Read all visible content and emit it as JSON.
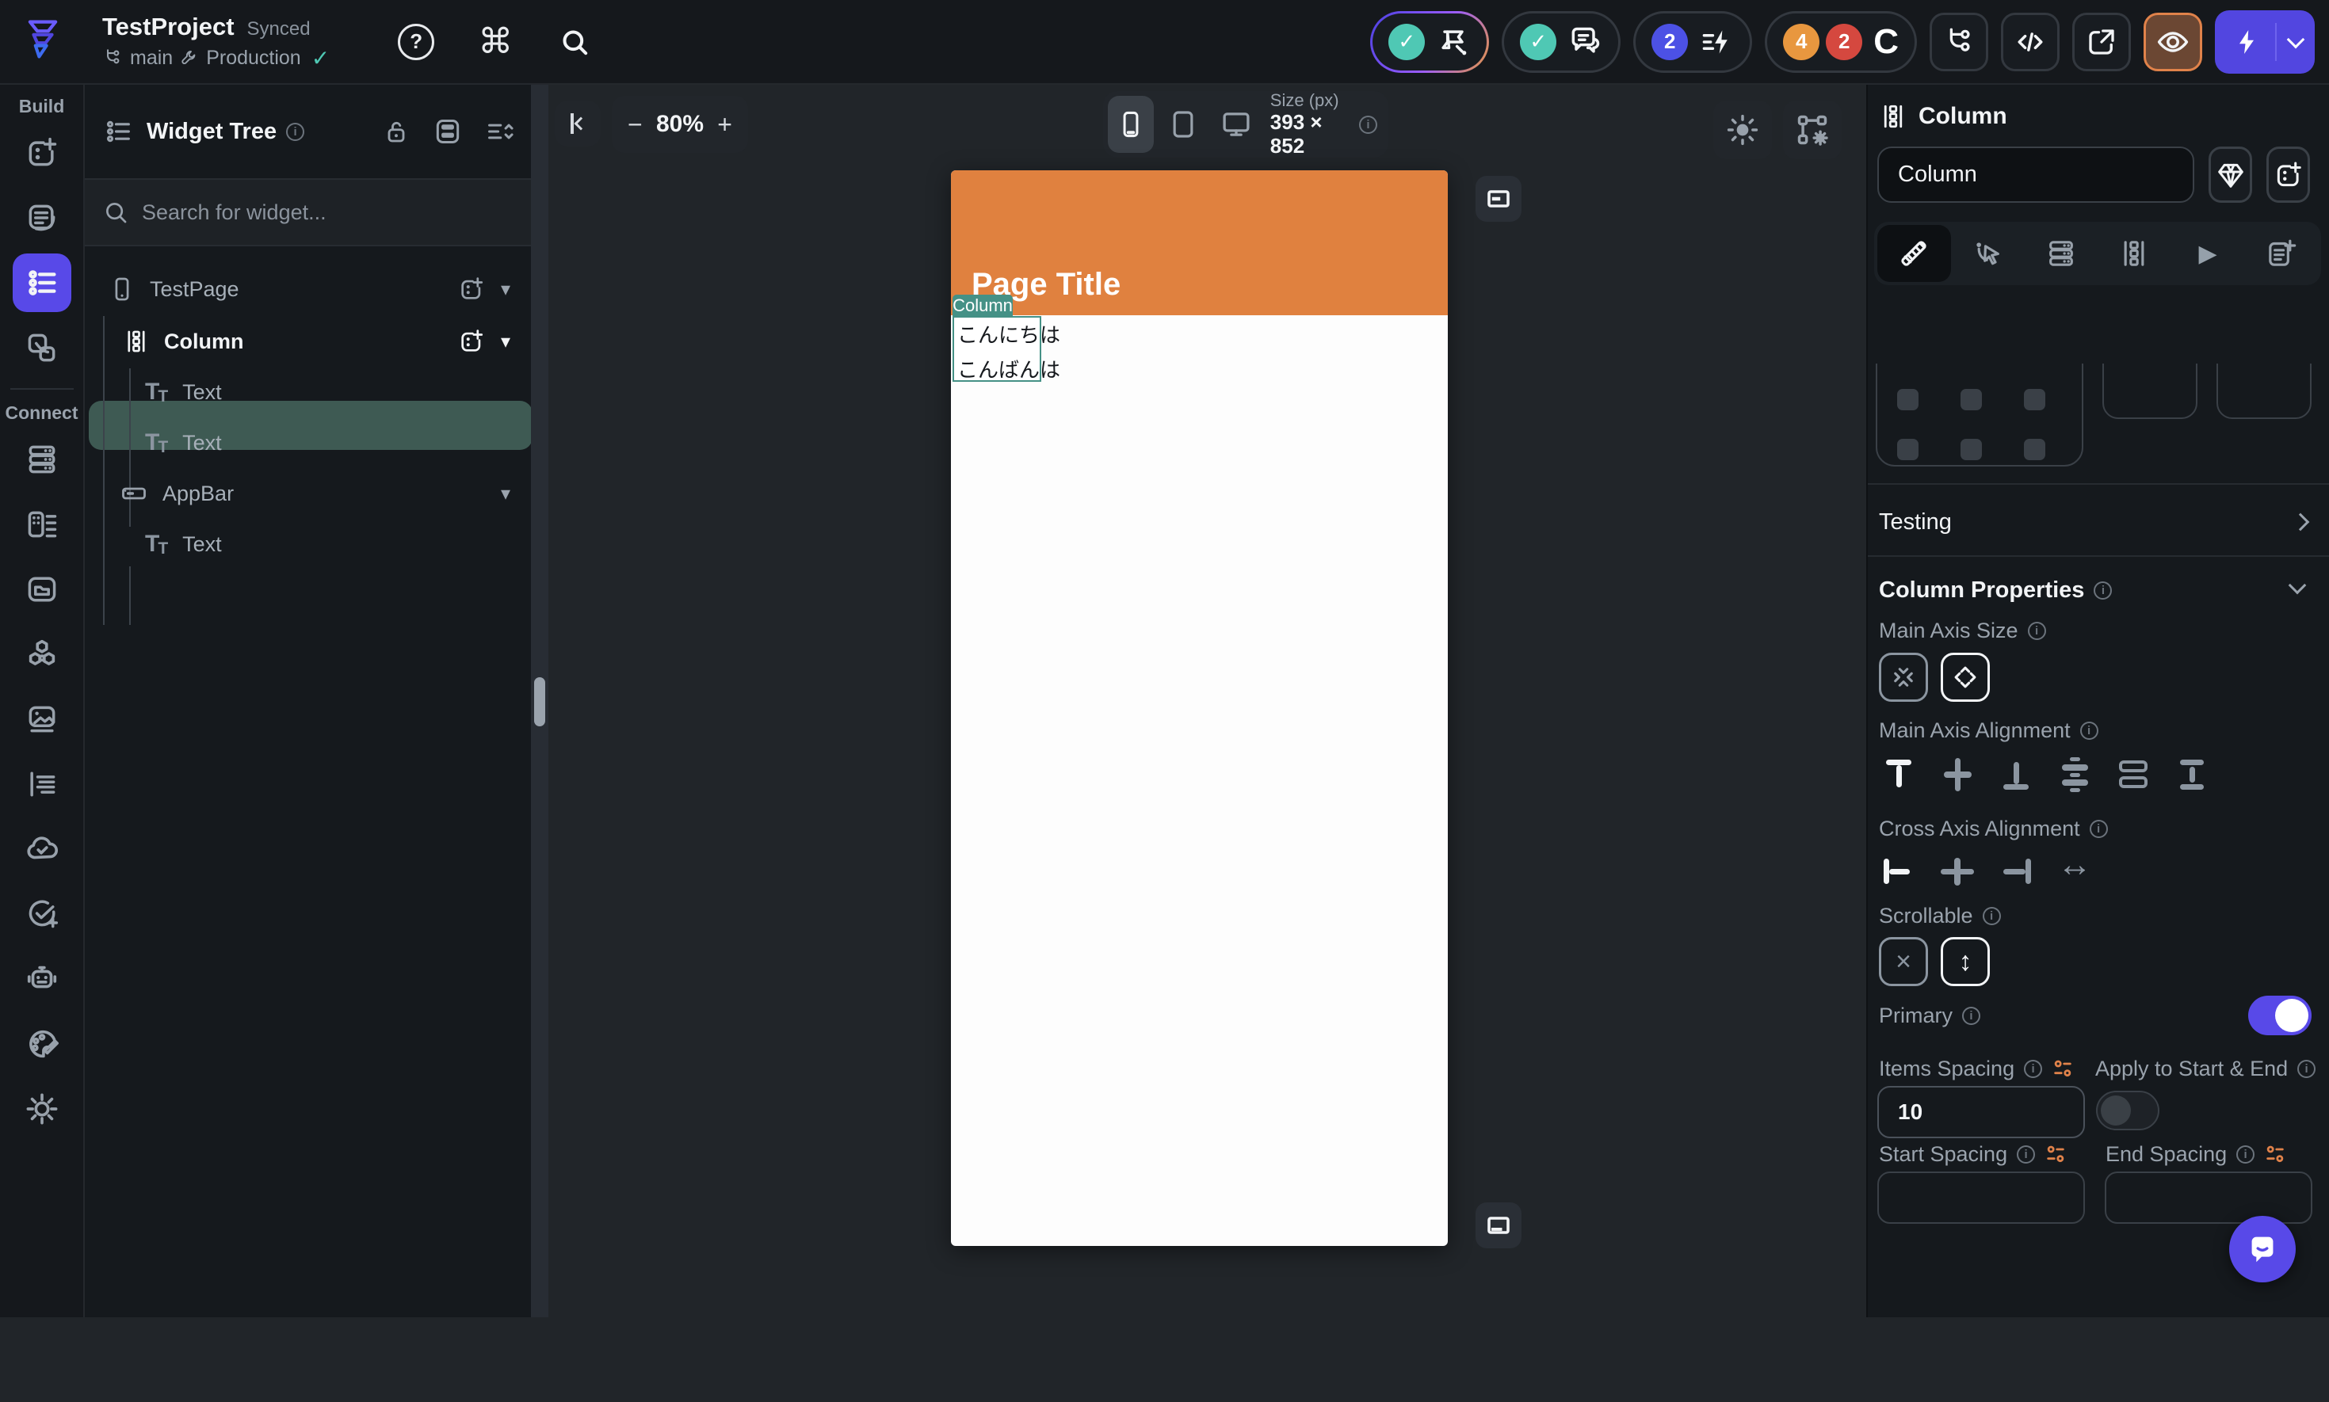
{
  "topbar": {
    "project_name": "TestProject",
    "sync_status": "Synced",
    "branch_name": "main",
    "environment": "Production",
    "help_glyph": "?",
    "command_glyph": "⌘",
    "pills": {
      "checks_glyph": "✓",
      "comments_glyph": "✓",
      "actions_count": "2",
      "warnings_count": "4",
      "errors_count": "2",
      "progress_glyph": "C"
    },
    "code_glyph": "</>"
  },
  "rail": {
    "sections": [
      {
        "label": "Build"
      },
      {
        "label": "Connect"
      }
    ]
  },
  "widget_tree": {
    "title": "Widget Tree",
    "search_placeholder": "Search for widget...",
    "items": [
      {
        "label": "TestPage",
        "type": "page"
      },
      {
        "label": "Column",
        "type": "column",
        "selected": true
      },
      {
        "label": "Text",
        "type": "text"
      },
      {
        "label": "Text",
        "type": "text"
      },
      {
        "label": "AppBar",
        "type": "appbar"
      },
      {
        "label": "Text",
        "type": "text"
      }
    ]
  },
  "canvas": {
    "zoom_out_glyph": "−",
    "zoom_level": "80%",
    "zoom_in_glyph": "+",
    "size_label": "Size (px)",
    "size_value": "393 × 852",
    "preview": {
      "app_bar_title": "Page Title",
      "selection_badge": "Column",
      "text_items": [
        "こんにちは",
        "こんばんは"
      ]
    }
  },
  "props_panel": {
    "widget_type": "Column",
    "name_value": "Column",
    "testing_label": "Testing",
    "section_title": "Column Properties",
    "main_axis_size_label": "Main Axis Size",
    "main_axis_alignment_label": "Main Axis Alignment",
    "cross_axis_alignment_label": "Cross Axis Alignment",
    "scrollable_label": "Scrollable",
    "primary_label": "Primary",
    "items_spacing_label": "Items Spacing",
    "items_spacing_value": "10",
    "apply_start_end_label": "Apply to Start & End",
    "start_spacing_label": "Start Spacing",
    "start_spacing_value": "",
    "end_spacing_label": "End Spacing",
    "end_spacing_value": "",
    "stretch_glyph": "↔",
    "scroll_glyph": "↕",
    "none_glyph": "×",
    "play_glyph": "▶"
  },
  "colors": {
    "accent_indigo": "#5849E8",
    "selection_teal": "#459186",
    "success_teal": "#4FC8B4",
    "app_bar_orange": "#E0813F",
    "warning_orange": "#E8973F",
    "error_red": "#D5483F",
    "canvas_bg": "#212529",
    "panel_bg": "#15191D"
  }
}
